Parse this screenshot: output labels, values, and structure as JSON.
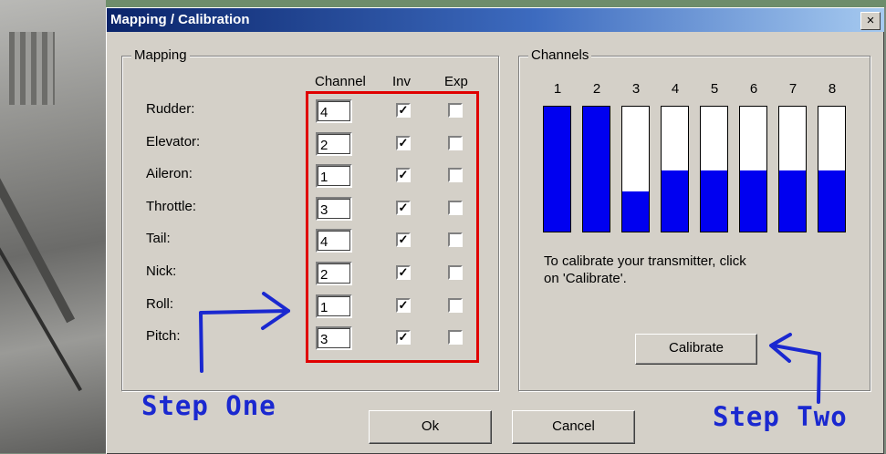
{
  "window": {
    "title": "Mapping / Calibration",
    "close_label": "×"
  },
  "mapping": {
    "group_label": "Mapping",
    "headers": {
      "channel": "Channel",
      "inv": "Inv",
      "exp": "Exp"
    },
    "rows": [
      {
        "label": "Rudder:",
        "channel": "4",
        "inv": true,
        "exp": false
      },
      {
        "label": "Elevator:",
        "channel": "2",
        "inv": true,
        "exp": false
      },
      {
        "label": "Aileron:",
        "channel": "1",
        "inv": true,
        "exp": false
      },
      {
        "label": "Throttle:",
        "channel": "3",
        "inv": true,
        "exp": false
      },
      {
        "label": "Tail:",
        "channel": "4",
        "inv": true,
        "exp": false
      },
      {
        "label": "Nick:",
        "channel": "2",
        "inv": true,
        "exp": false
      },
      {
        "label": "Roll:",
        "channel": "1",
        "inv": true,
        "exp": false
      },
      {
        "label": "Pitch:",
        "channel": "3",
        "inv": true,
        "exp": false
      }
    ]
  },
  "channels": {
    "group_label": "Channels",
    "items": [
      {
        "label": "1",
        "level": 1.0
      },
      {
        "label": "2",
        "level": 1.0
      },
      {
        "label": "3",
        "level": 0.32
      },
      {
        "label": "4",
        "level": 0.49
      },
      {
        "label": "5",
        "level": 0.49
      },
      {
        "label": "6",
        "level": 0.49
      },
      {
        "label": "7",
        "level": 0.49
      },
      {
        "label": "8",
        "level": 0.49
      }
    ],
    "bar_color": "#0000f0",
    "note_line1": "To calibrate your transmitter, click",
    "note_line2": "on 'Calibrate'.",
    "calibrate_label": "Calibrate"
  },
  "footer": {
    "ok_label": "Ok",
    "cancel_label": "Cancel"
  },
  "annotations": {
    "step_one": "Step One",
    "step_two": "Step Two",
    "frame_color": "#e00000",
    "ink_color": "#1a28d0"
  }
}
